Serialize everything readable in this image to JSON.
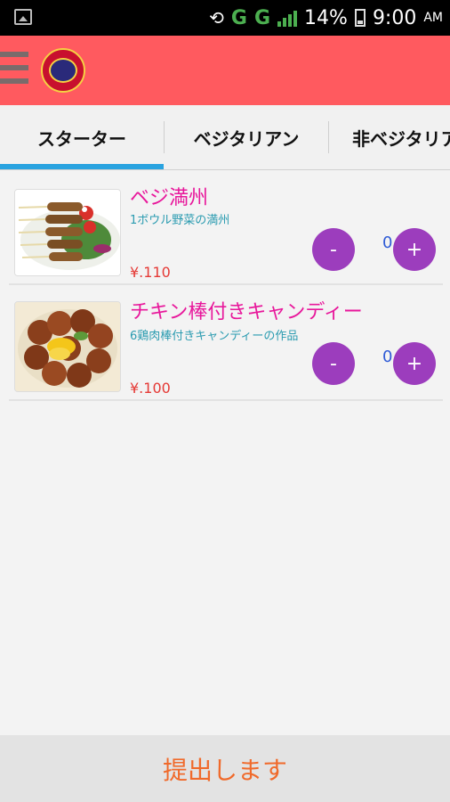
{
  "status_bar": {
    "network": "G",
    "network2": "G",
    "battery_percent": "14%",
    "time": "9:00",
    "ampm": "AM",
    "icons": [
      "image-icon",
      "rotate-icon",
      "signal-icon",
      "battery-icon"
    ]
  },
  "app_bar": {
    "menu_icon": "menu-icon",
    "logo": "restaurant-logo"
  },
  "tabs": [
    {
      "label": "スターター",
      "active": true
    },
    {
      "label": "ベジタリアン",
      "active": false
    },
    {
      "label": "非ベジタリア",
      "active": false
    }
  ],
  "items": [
    {
      "name": "ベジ満州",
      "description": "1ボウル野菜の満州",
      "price": "¥.110",
      "quantity": "0",
      "minus": "-",
      "plus": "+"
    },
    {
      "name": "チキン棒付きキャンディー",
      "description": "6鶏肉棒付きキャンディーの作品",
      "price": "¥.100",
      "quantity": "0",
      "minus": "-",
      "plus": "+"
    }
  ],
  "submit": {
    "label": "提出します"
  },
  "colors": {
    "app_bar": "#ff5a5f",
    "tab_indicator": "#29a3e0",
    "qty_button": "#9c3dbd",
    "item_name": "#e8179b",
    "price": "#e53935",
    "submit_text": "#f06a2b"
  }
}
